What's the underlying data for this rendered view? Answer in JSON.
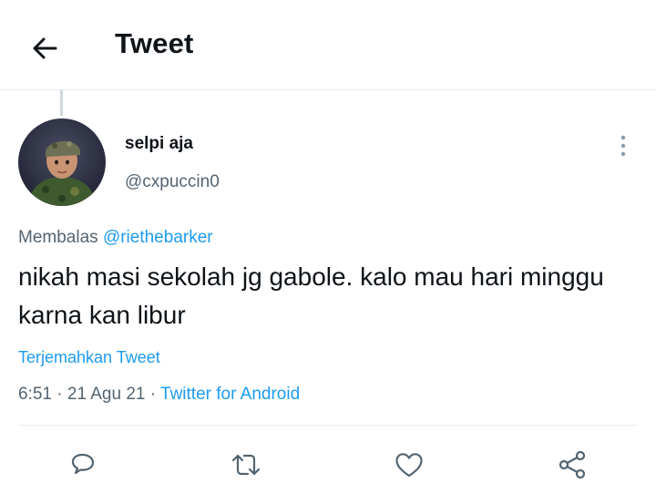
{
  "header": {
    "title": "Tweet",
    "back_icon": "arrow-left-icon"
  },
  "tweet": {
    "author": {
      "display_name": "selpi aja",
      "handle": "@cxpuccin0"
    },
    "reply_prefix": "Membalas",
    "reply_to": "@riethebarker",
    "text": "nikah masi sekolah jg gabole. kalo mau hari minggu karna kan libur",
    "translate_label": "Terjemahkan Tweet",
    "time": "6:51",
    "date": "21 Agu 21",
    "source": "Twitter for Android",
    "separator": "·"
  },
  "actions": [
    {
      "icon": "reply-icon"
    },
    {
      "icon": "retweet-icon"
    },
    {
      "icon": "like-icon"
    },
    {
      "icon": "share-icon"
    }
  ],
  "colors": {
    "accent": "#1d9bf0",
    "text": "#0f1419",
    "secondary": "#536471",
    "border": "#e6ecf0"
  }
}
